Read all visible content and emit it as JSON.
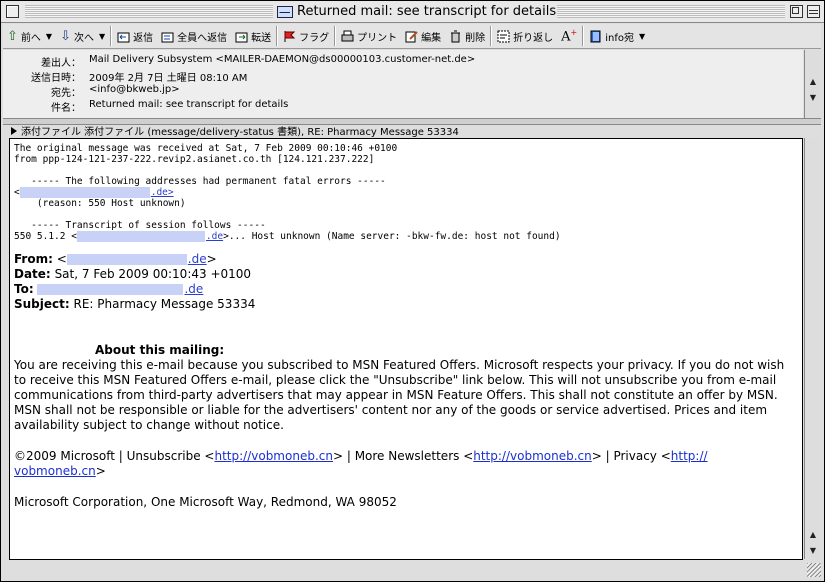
{
  "window": {
    "title": "Returned mail: see transcript for details"
  },
  "toolbar": {
    "prev": "前へ",
    "next": "次へ",
    "reply": "返信",
    "reply_all": "全員へ返信",
    "forward": "転送",
    "flag": "フラグ",
    "print": "プリント",
    "edit": "編集",
    "delete": "削除",
    "wrap": "折り返し",
    "recipient": "info宛"
  },
  "header": {
    "from_label": "差出人：",
    "from_value": "Mail Delivery Subsystem <MAILER-DAEMON@ds00000103.customer-net.de>",
    "date_label": "送信日時：",
    "date_value": "2009年 2月 7日 土曜日 08:10 AM",
    "to_label": "宛先：",
    "to_value": "<info@bkweb.jp>",
    "subject_label": "件名：",
    "subject_value": "Returned mail: see transcript for details"
  },
  "attachment": {
    "text": "添付ファイル 添付ファイル (message/delivery-status 書類), RE: Pharmacy Message 53334"
  },
  "message": {
    "line1": "The original message was received at Sat, 7 Feb 2009 00:10:46 +0100",
    "line2": "from ppp-124-121-237-222.revip2.asianet.co.th [124.121.237.222]",
    "line3": "   ----- The following addresses had permanent fatal errors -----",
    "line4_prefix": "<",
    "line4_suffix": ".de>",
    "line5": "    (reason: 550 Host unknown)",
    "line6": "   ----- Transcript of session follows -----",
    "line7_prefix": "550 5.1.2 <",
    "line7_domain": ".de",
    "line7_suffix": ">... Host unknown (Name server: -bkw-fw.de: host not found)",
    "from_label": "From:",
    "from_prefix": "<",
    "from_domain": ".de",
    "from_suffix": ">",
    "date_label": "Date:",
    "date_value": "Sat, 7 Feb 2009 00:10:43 +0100",
    "to_label": "To:",
    "to_domain": ".de",
    "subject_label": "Subject:",
    "subject_value": "RE: Pharmacy Message 53334",
    "about_heading": "About this mailing:",
    "about_text": "You are receiving this e-mail because you subscribed to MSN Featured Offers. Microsoft respects your privacy. If you do not wish to receive this MSN Featured Offers e-mail, please click the \"Unsubscribe\" link below. This will not unsubscribe you from e-mail communications from third-party advertisers that may appear in MSN Feature Offers. This shall not constitute an offer by MSN. MSN shall not be responsible or liable for the advertisers' content nor any of the goods or service advertised. Prices and item availability subject to change without notice.",
    "footer_copyright": "©2009 Microsoft | Unsubscribe <",
    "footer_link1": "http://vobmoneb.cn",
    "footer_mid1": ">  | More Newsletters <",
    "footer_link2": "http://vobmoneb.cn",
    "footer_mid2": ">  | Privacy <",
    "footer_link3a": "http://",
    "footer_link3b": "vobmoneb.cn",
    "footer_end": ">",
    "address": "Microsoft Corporation, One Microsoft Way, Redmond, WA 98052"
  }
}
